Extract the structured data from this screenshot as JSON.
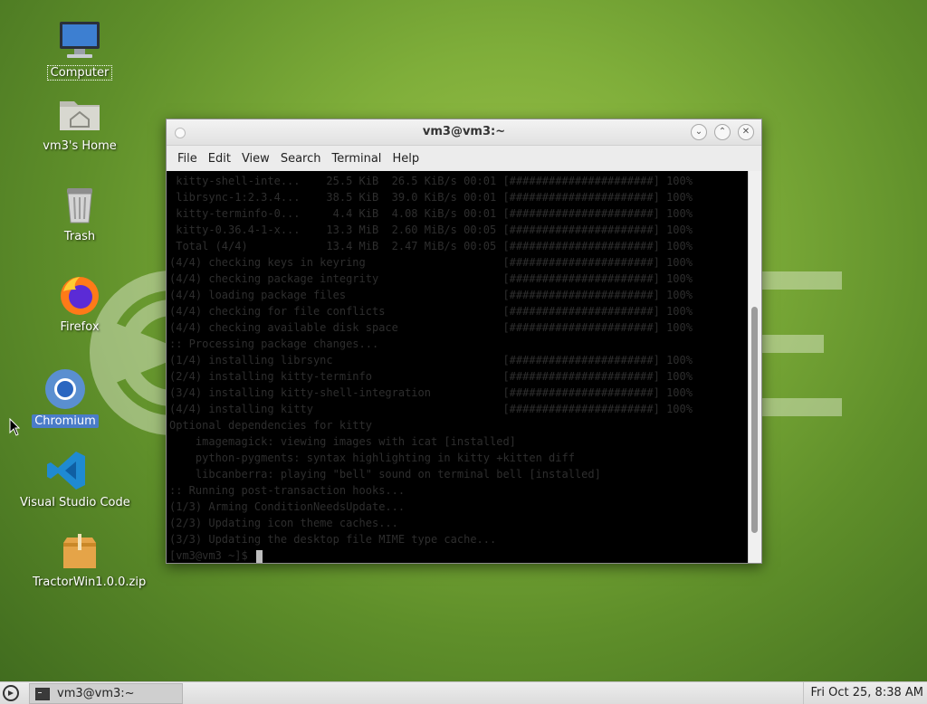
{
  "desktop": {
    "icons": [
      {
        "label": "Computer"
      },
      {
        "label": "vm3's Home"
      },
      {
        "label": "Trash"
      },
      {
        "label": "Firefox"
      },
      {
        "label": "Chromium"
      },
      {
        "label": "Visual Studio Code"
      },
      {
        "label": "TractorWin1.0.0.zip"
      }
    ]
  },
  "window": {
    "title": "vm3@vm3:~",
    "menu": [
      "File",
      "Edit",
      "View",
      "Search",
      "Terminal",
      "Help"
    ],
    "terminal_lines": [
      " kitty-shell-inte...    25.5 KiB  26.5 KiB/s 00:01 [######################] 100%",
      " librsync-1:2.3.4...    38.5 KiB  39.0 KiB/s 00:01 [######################] 100%",
      " kitty-terminfo-0...     4.4 KiB  4.08 KiB/s 00:01 [######################] 100%",
      " kitty-0.36.4-1-x...    13.3 MiB  2.60 MiB/s 00:05 [######################] 100%",
      " Total (4/4)            13.4 MiB  2.47 MiB/s 00:05 [######################] 100%",
      "(4/4) checking keys in keyring                     [######################] 100%",
      "(4/4) checking package integrity                   [######################] 100%",
      "(4/4) loading package files                        [######################] 100%",
      "(4/4) checking for file conflicts                  [######################] 100%",
      "(4/4) checking available disk space                [######################] 100%",
      ":: Processing package changes...",
      "(1/4) installing librsync                          [######################] 100%",
      "(2/4) installing kitty-terminfo                    [######################] 100%",
      "(3/4) installing kitty-shell-integration           [######################] 100%",
      "(4/4) installing kitty                             [######################] 100%",
      "Optional dependencies for kitty",
      "    imagemagick: viewing images with icat [installed]",
      "    python-pygments: syntax highlighting in kitty +kitten diff",
      "    libcanberra: playing \"bell\" sound on terminal bell [installed]",
      ":: Running post-transaction hooks...",
      "(1/3) Arming ConditionNeedsUpdate...",
      "(2/3) Updating icon theme caches...",
      "(3/3) Updating the desktop file MIME type cache...",
      "[vm3@vm3 ~]$ "
    ]
  },
  "taskbar": {
    "task_label": "vm3@vm3:~",
    "clock": "Fri Oct 25,  8:38 AM"
  }
}
